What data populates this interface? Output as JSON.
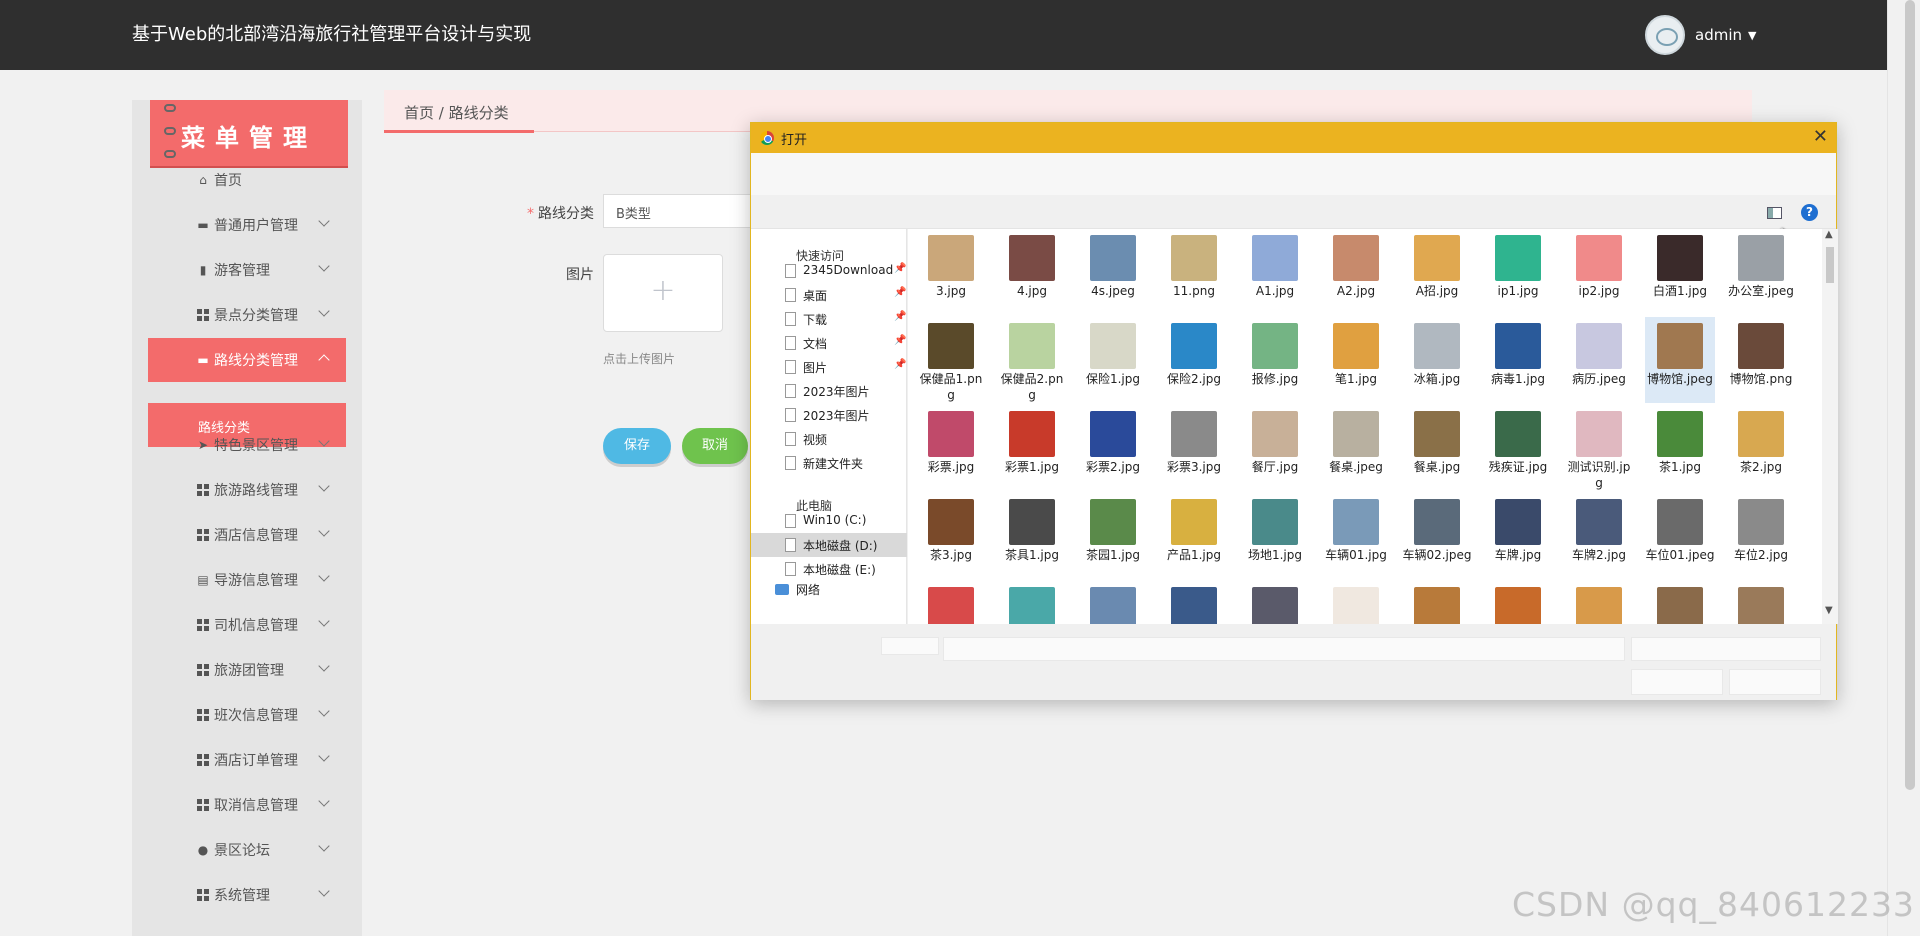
{
  "header": {
    "app_title": "基于Web的北部湾沿海旅行社管理平台设计与实现",
    "username": "admin"
  },
  "sidebar": {
    "banner_title": "菜单管理",
    "items": [
      {
        "label": "首页",
        "icon": "home-icon",
        "expandable": false
      },
      {
        "label": "普通用户管理",
        "icon": "monitor-icon",
        "expandable": true
      },
      {
        "label": "游客管理",
        "icon": "bar-chart-icon",
        "expandable": true
      },
      {
        "label": "景点分类管理",
        "icon": "grid-icon",
        "expandable": true
      },
      {
        "label": "路线分类管理",
        "icon": "monitor-icon",
        "expandable": true,
        "active": true
      },
      {
        "label": "特色景区管理",
        "icon": "send-icon",
        "expandable": true
      },
      {
        "label": "旅游路线管理",
        "icon": "grid-icon",
        "expandable": true
      },
      {
        "label": "酒店信息管理",
        "icon": "grid-icon",
        "expandable": true
      },
      {
        "label": "导游信息管理",
        "icon": "id-card-icon",
        "expandable": true
      },
      {
        "label": "司机信息管理",
        "icon": "grid-icon",
        "expandable": true
      },
      {
        "label": "旅游团管理",
        "icon": "grid-icon",
        "expandable": true
      },
      {
        "label": "班次信息管理",
        "icon": "grid-icon",
        "expandable": true
      },
      {
        "label": "酒店订单管理",
        "icon": "grid-icon",
        "expandable": true
      },
      {
        "label": "取消信息管理",
        "icon": "grid-icon",
        "expandable": true
      },
      {
        "label": "景区论坛",
        "icon": "user-icon",
        "expandable": true
      },
      {
        "label": "系统管理",
        "icon": "grid-icon",
        "expandable": true
      }
    ],
    "submenu_label": "路线分类"
  },
  "breadcrumb": "首页 / 路线分类",
  "form": {
    "route_label": "路线分类",
    "route_value": "B类型",
    "image_label": "图片",
    "upload_hint": "点击上传图片",
    "save_label": "保存",
    "cancel_label": "取消"
  },
  "dialog": {
    "title": "打开",
    "close": "✕",
    "help": "?",
    "quick_access_label": "快速访问",
    "quick_access": [
      {
        "label": "2345Download",
        "pinned": true
      },
      {
        "label": "桌面",
        "pinned": true
      },
      {
        "label": "下载",
        "pinned": true
      },
      {
        "label": "文档",
        "pinned": true
      },
      {
        "label": "图片",
        "pinned": true
      },
      {
        "label": "2023年图片",
        "pinned": false
      },
      {
        "label": "2023年图片",
        "pinned": false
      },
      {
        "label": "视频",
        "pinned": false
      },
      {
        "label": "新建文件夹",
        "pinned": false
      }
    ],
    "this_pc_label": "此电脑",
    "drives": [
      {
        "label": "Win10 (C:)",
        "selected": false
      },
      {
        "label": "本地磁盘 (D:)",
        "selected": true
      },
      {
        "label": "本地磁盘 (E:)",
        "selected": false
      }
    ],
    "network_label": "网络",
    "files": [
      {
        "name": "3.jpg",
        "color": "#caa77a"
      },
      {
        "name": "4.jpg",
        "color": "#7a4b45"
      },
      {
        "name": "4s.jpeg",
        "color": "#6b8db0"
      },
      {
        "name": "11.png",
        "color": "#c9b27e"
      },
      {
        "name": "A1.jpg",
        "color": "#8faad8"
      },
      {
        "name": "A2.jpg",
        "color": "#c78a6c"
      },
      {
        "name": "A招.jpg",
        "color": "#e0a850"
      },
      {
        "name": "ip1.jpg",
        "color": "#2fb48f"
      },
      {
        "name": "ip2.jpg",
        "color": "#f08a8a"
      },
      {
        "name": "白酒1.jpg",
        "color": "#3a2a2a"
      },
      {
        "name": "办公室.jpeg",
        "color": "#9aa0a6"
      },
      {
        "name": "保健品1.png",
        "color": "#5a4a2a"
      },
      {
        "name": "保健品2.png",
        "color": "#b9d3a0"
      },
      {
        "name": "保险1.jpg",
        "color": "#d8d8c8"
      },
      {
        "name": "保险2.jpg",
        "color": "#2a88c8"
      },
      {
        "name": "报修.jpg",
        "color": "#74b484"
      },
      {
        "name": "笔1.jpg",
        "color": "#e0a040"
      },
      {
        "name": "冰箱.jpg",
        "color": "#b0b8c0"
      },
      {
        "name": "病毒1.jpg",
        "color": "#2a5a9a"
      },
      {
        "name": "病历.jpeg",
        "color": "#c8c8e0"
      },
      {
        "name": "博物馆.jpeg",
        "color": "#a07850",
        "selected": true
      },
      {
        "name": "博物馆.png",
        "color": "#6a4a3a"
      },
      {
        "name": "彩票.jpg",
        "color": "#c04a6a"
      },
      {
        "name": "彩票1.jpg",
        "color": "#c83a2a"
      },
      {
        "name": "彩票2.jpg",
        "color": "#2a4a9a"
      },
      {
        "name": "彩票3.jpg",
        "color": "#8a8a8a"
      },
      {
        "name": "餐厅.jpg",
        "color": "#c8b098"
      },
      {
        "name": "餐桌.jpeg",
        "color": "#b8b0a0"
      },
      {
        "name": "餐桌.jpg",
        "color": "#8a7048"
      },
      {
        "name": "残疾证.jpg",
        "color": "#3a6a4a"
      },
      {
        "name": "测试识别.jpg",
        "color": "#e0b8c0"
      },
      {
        "name": "茶1.jpg",
        "color": "#4a8a3a"
      },
      {
        "name": "茶2.jpg",
        "color": "#d8a850"
      },
      {
        "name": "茶3.jpg",
        "color": "#7a4a2a"
      },
      {
        "name": "茶具1.jpg",
        "color": "#4a4a4a"
      },
      {
        "name": "茶园1.jpg",
        "color": "#5a8a4a"
      },
      {
        "name": "产品1.jpg",
        "color": "#d8b040"
      },
      {
        "name": "场地1.jpg",
        "color": "#4a8a8a"
      },
      {
        "name": "车辆01.jpg",
        "color": "#7a9ab8"
      },
      {
        "name": "车辆02.jpeg",
        "color": "#5a6a7a"
      },
      {
        "name": "车牌.jpg",
        "color": "#3a4a6a"
      },
      {
        "name": "车牌2.jpg",
        "color": "#4a5a7a"
      },
      {
        "name": "车位01.jpeg",
        "color": "#6a6a6a"
      },
      {
        "name": "车位2.jpg",
        "color": "#8a8a8a"
      },
      {
        "name": "",
        "color": "#d84a4a"
      },
      {
        "name": "",
        "color": "#4aa8a8"
      },
      {
        "name": "",
        "color": "#6a8ab0"
      },
      {
        "name": "",
        "color": "#3a5a8a"
      },
      {
        "name": "",
        "color": "#5a5a6a"
      },
      {
        "name": "",
        "color": "#f0e8e0"
      },
      {
        "name": "",
        "color": "#b87a3a"
      },
      {
        "name": "",
        "color": "#c86a2a"
      },
      {
        "name": "",
        "color": "#d89a4a"
      },
      {
        "name": "",
        "color": "#8a6a4a"
      },
      {
        "name": "",
        "color": "#9a7a5a"
      }
    ]
  },
  "watermark": "CSDN @qq_840612233"
}
